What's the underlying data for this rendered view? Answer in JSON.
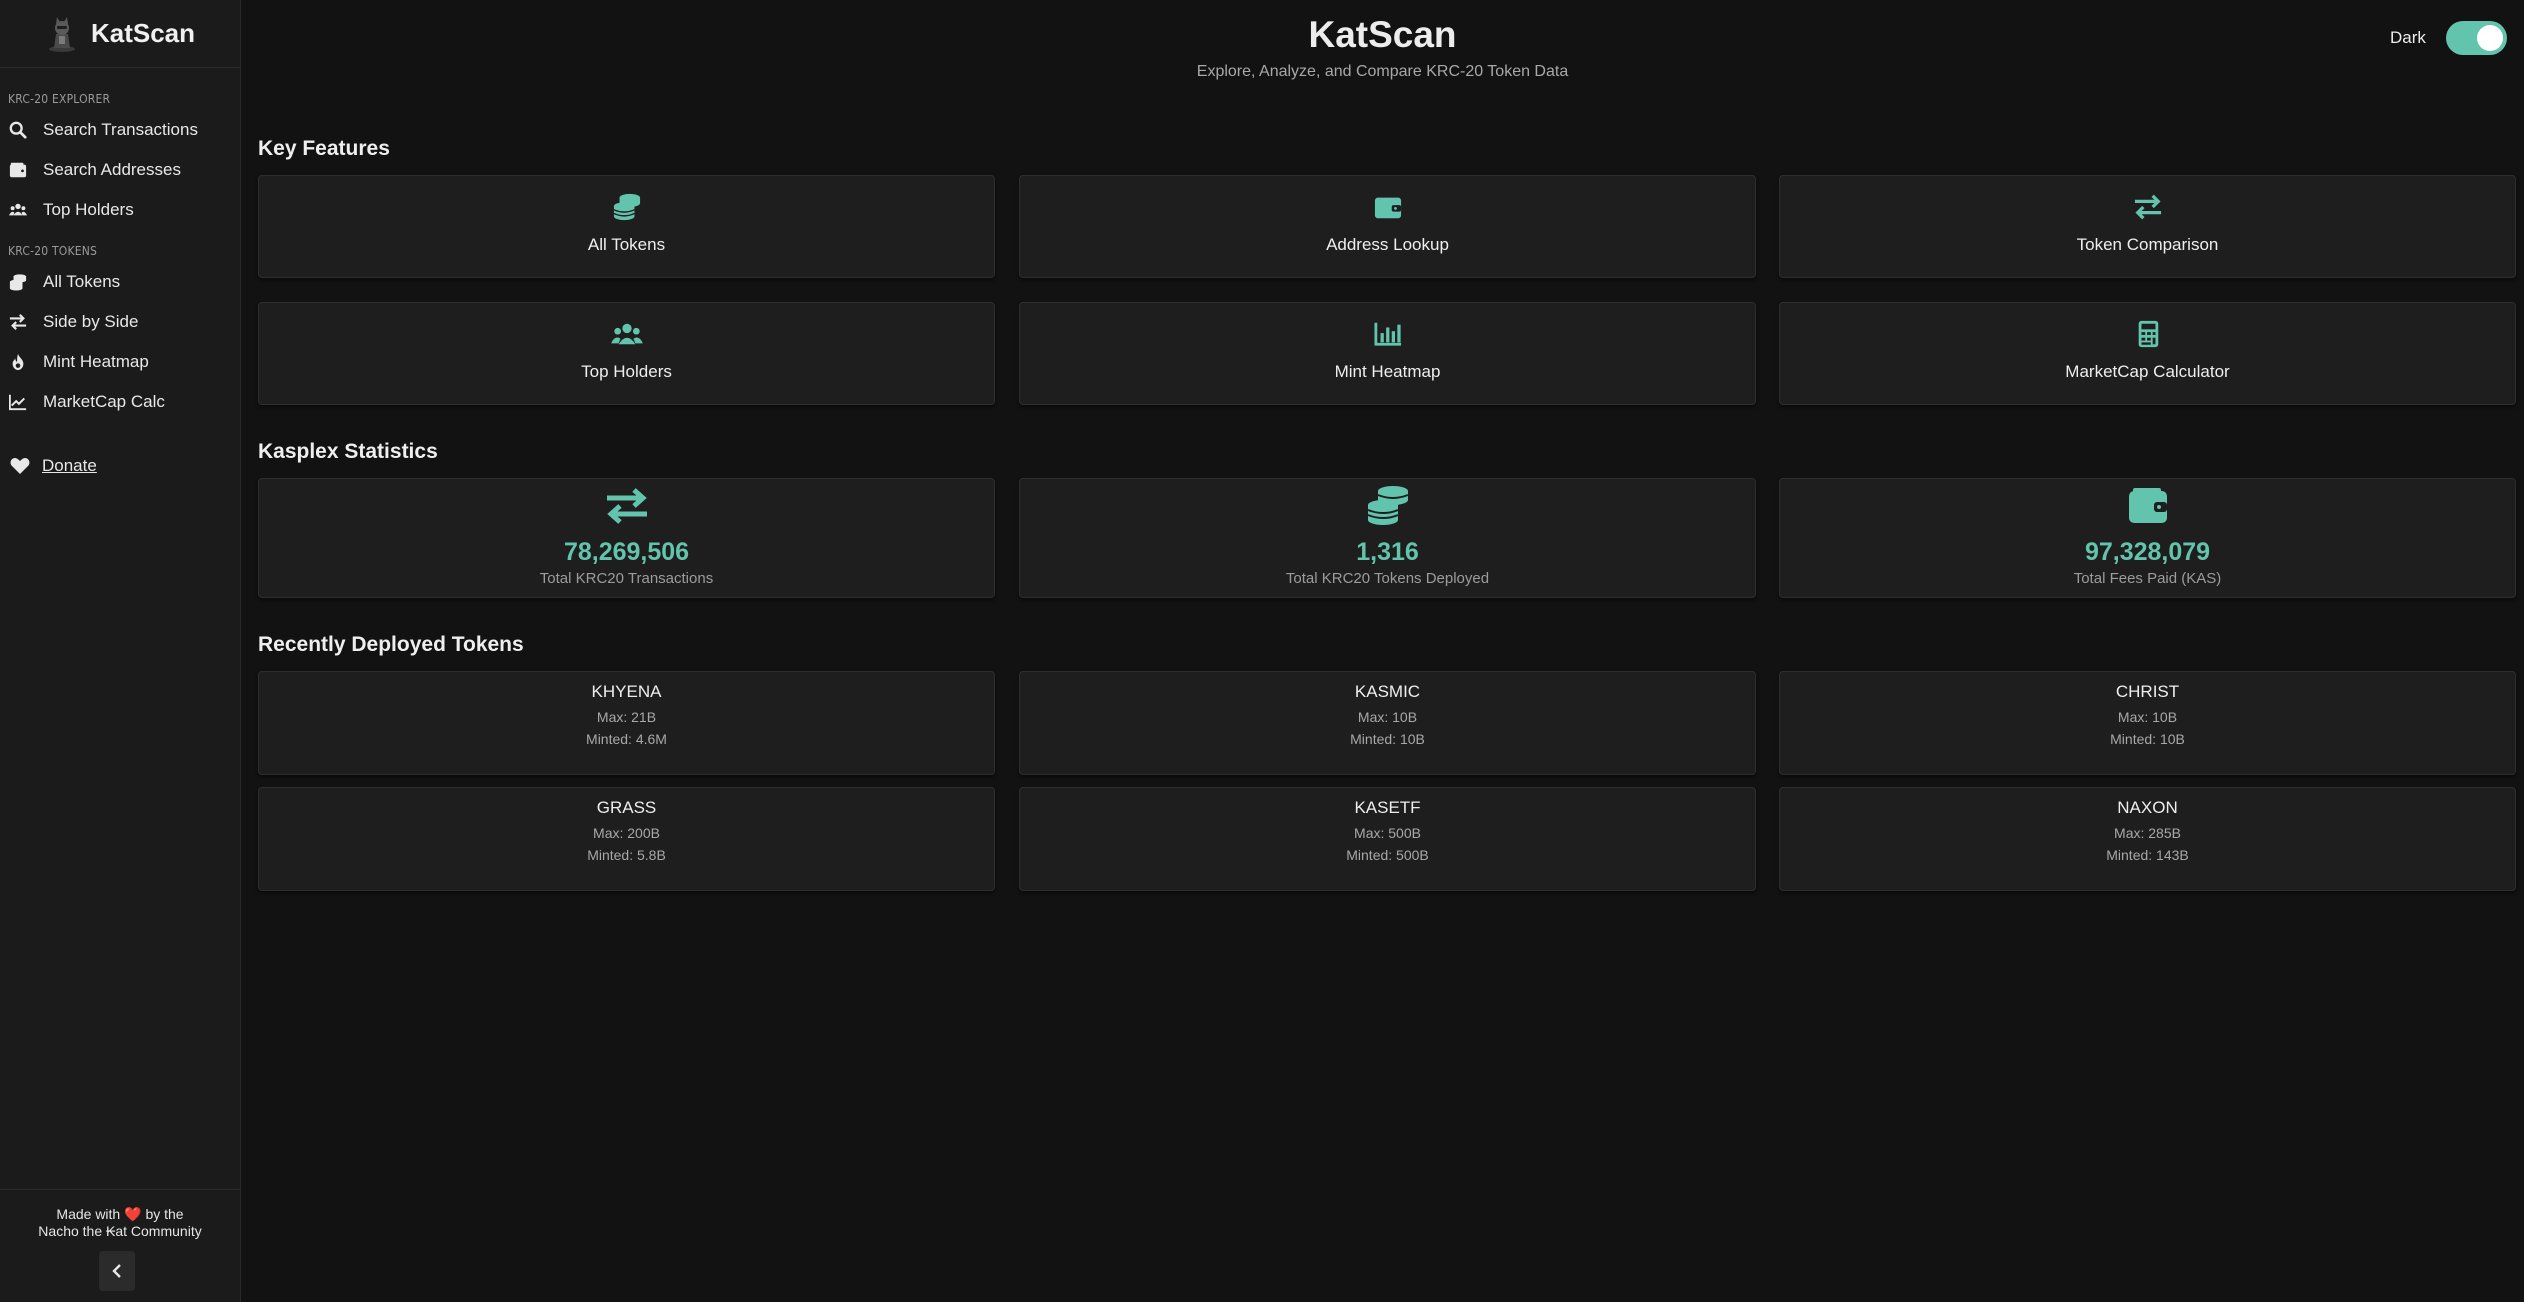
{
  "app": {
    "name": "KatScan"
  },
  "sidebar": {
    "explorer_label": "KRC-20 Explorer",
    "explorer_items": [
      {
        "label": "Search Transactions",
        "icon": "search-icon"
      },
      {
        "label": "Search Addresses",
        "icon": "wallet-icon"
      },
      {
        "label": "Top Holders",
        "icon": "users-icon"
      }
    ],
    "tokens_label": "KRC-20 Tokens",
    "token_items": [
      {
        "label": "All Tokens",
        "icon": "coins-icon"
      },
      {
        "label": "Side by Side",
        "icon": "arrows-exchange-icon"
      },
      {
        "label": "Mint Heatmap",
        "icon": "fire-icon"
      },
      {
        "label": "MarketCap Calc",
        "icon": "chart-line-icon"
      }
    ],
    "donate_label": "Donate",
    "footer_line1": "Made with",
    "footer_line1b": "by the",
    "footer_line2": "Nacho the ₭at Community"
  },
  "header": {
    "title": "KatScan",
    "subtitle": "Explore, Analyze, and Compare KRC-20 Token Data",
    "theme_label": "Dark"
  },
  "key_features": {
    "title": "Key Features",
    "items": [
      {
        "label": "All Tokens",
        "icon": "coins-icon"
      },
      {
        "label": "Address Lookup",
        "icon": "wallet-icon"
      },
      {
        "label": "Token Comparison",
        "icon": "arrows-exchange-icon"
      },
      {
        "label": "Top Holders",
        "icon": "users-icon"
      },
      {
        "label": "Mint Heatmap",
        "icon": "bar-chart-icon"
      },
      {
        "label": "MarketCap Calculator",
        "icon": "calculator-icon"
      }
    ]
  },
  "stats": {
    "title": "Kasplex Statistics",
    "items": [
      {
        "value": "78,269,506",
        "label": "Total KRC20 Transactions",
        "icon": "arrows-exchange-icon"
      },
      {
        "value": "1,316",
        "label": "Total KRC20 Tokens Deployed",
        "icon": "coins-icon"
      },
      {
        "value": "97,328,079",
        "label": "Total Fees Paid (KAS)",
        "icon": "wallet-icon"
      }
    ]
  },
  "recent_tokens": {
    "title": "Recently Deployed Tokens",
    "items": [
      {
        "name": "KHYENA",
        "max": "Max: 21B",
        "minted": "Minted: 4.6M"
      },
      {
        "name": "KASMIC",
        "max": "Max: 10B",
        "minted": "Minted: 10B"
      },
      {
        "name": "CHRIST",
        "max": "Max: 10B",
        "minted": "Minted: 10B"
      },
      {
        "name": "GRASS",
        "max": "Max: 200B",
        "minted": "Minted: 5.8B"
      },
      {
        "name": "KASETF",
        "max": "Max: 500B",
        "minted": "Minted: 500B"
      },
      {
        "name": "NAXON",
        "max": "Max: 285B",
        "minted": "Minted: 143B"
      }
    ]
  },
  "colors": {
    "accent": "#63c4ad",
    "background": "#121212",
    "card": "#1e1e1e",
    "sidebar": "#1b1b1b"
  }
}
